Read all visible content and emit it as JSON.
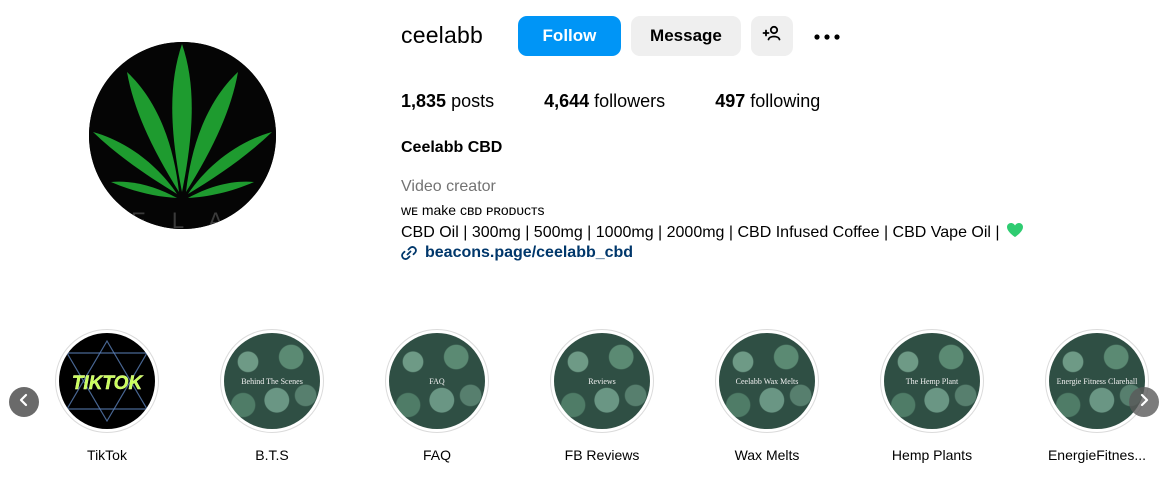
{
  "profile": {
    "username": "ceelabb",
    "avatar_letters": "E L A",
    "follow_label": "Follow",
    "message_label": "Message",
    "add_user_icon": "add-user-icon",
    "more_icon": "more-icon",
    "stats": {
      "posts_count": "1,835",
      "posts_label": "posts",
      "followers_count": "4,644",
      "followers_label": "followers",
      "following_count": "497",
      "following_label": "following"
    },
    "full_name": "Ceelabb CBD",
    "category": "Video creator",
    "bio_line1": "ᴡᴇ make ᴄʙᴅ ᴘʀᴏᴅᴜᴄᴛs",
    "bio_line2": "CBD Oil | 300mg | 500mg | 1000mg | 2000mg | CBD Infused Coffee | CBD Vape Oil |",
    "link_text": "beacons.page/ceelabb_cbd",
    "colors": {
      "follow_button": "#0095f6",
      "secondary_button": "#efefef",
      "link": "#00376b",
      "heart": "#2ecc71",
      "leaf": "#1e9b2f"
    }
  },
  "highlights": [
    {
      "label": "TikTok",
      "cover_text": "TIKTOK",
      "style": "tiktok"
    },
    {
      "label": "B.T.S",
      "cover_text": "Behind The Scenes",
      "style": "leaf"
    },
    {
      "label": "FAQ",
      "cover_text": "FAQ",
      "style": "leaf"
    },
    {
      "label": "FB Reviews",
      "cover_text": "Reviews",
      "style": "leaf"
    },
    {
      "label": "Wax Melts",
      "cover_text": "Ceelabb Wax Melts",
      "style": "leaf"
    },
    {
      "label": "Hemp Plants",
      "cover_text": "The Hemp Plant",
      "style": "leaf"
    },
    {
      "label": "EnergieFitnes...",
      "cover_text": "Energie Fitness Clarehall",
      "style": "leaf"
    }
  ],
  "nav": {
    "prev_icon": "chevron-left-icon",
    "next_icon": "chevron-right-icon"
  }
}
